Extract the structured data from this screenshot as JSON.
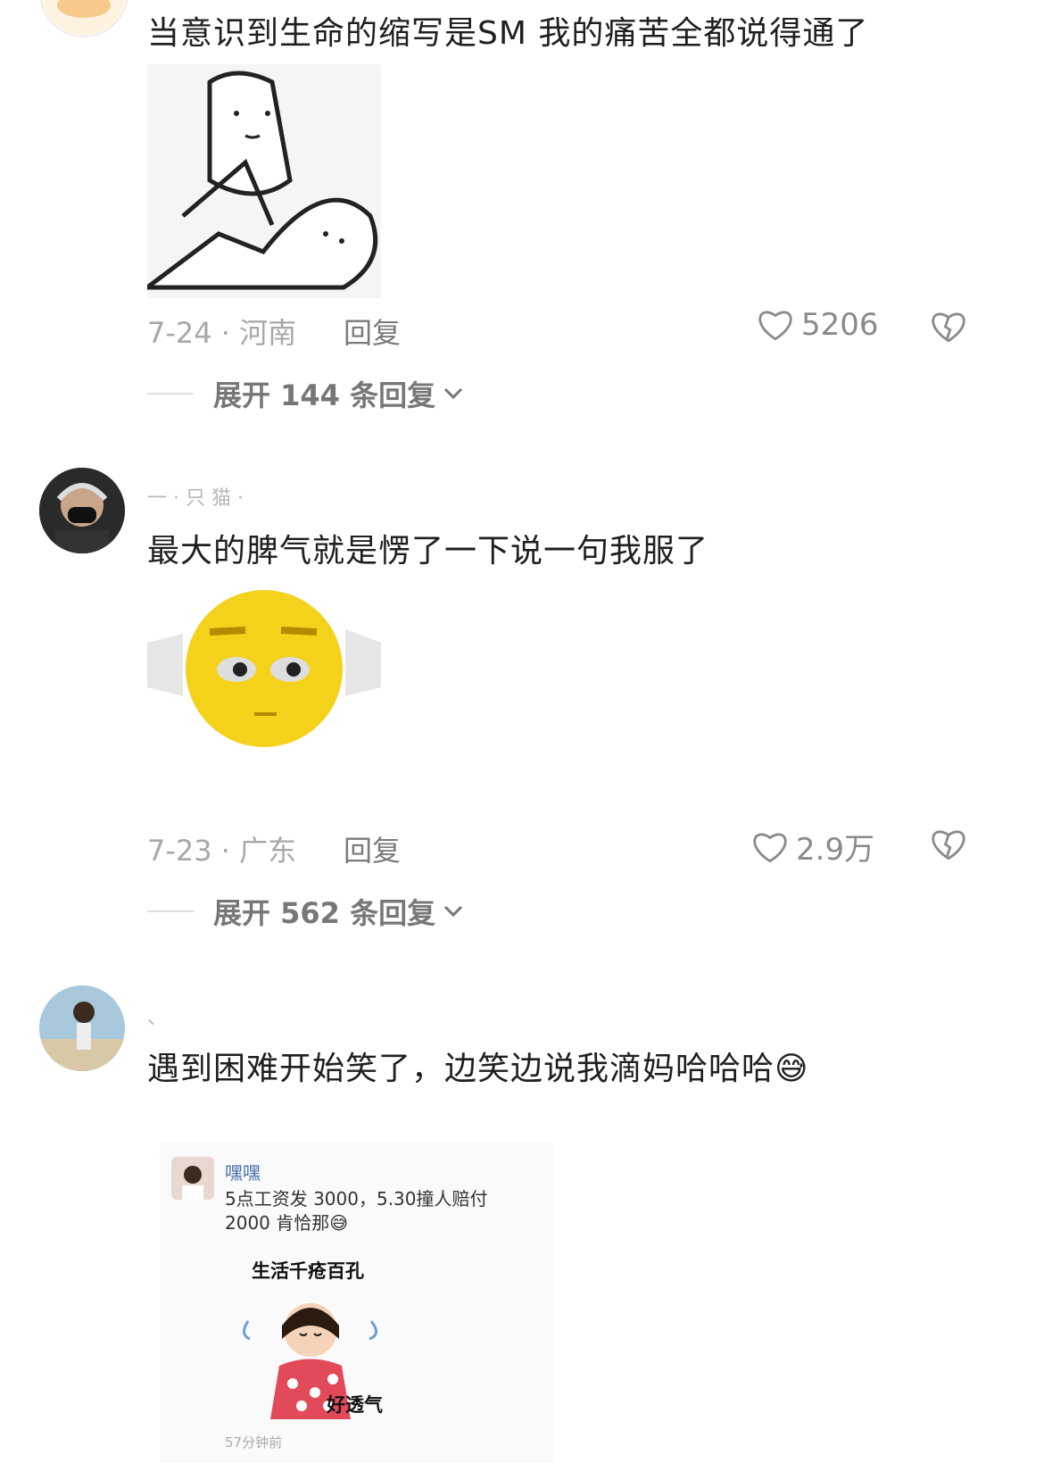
{
  "comments": [
    {
      "text": "当意识到生命的缩写是SM 我的痛苦全都说得通了",
      "date_location": "7-24 · 河南",
      "reply_label": "回复",
      "likes": "5206",
      "expand_label": "展开 144 条回复"
    },
    {
      "username": "一 · 只 猫 ·",
      "text": "最大的脾气就是愣了一下说一句我服了",
      "date_location": "7-23 · 广东",
      "reply_label": "回复",
      "likes": "2.9万",
      "expand_label": "展开 562 条回复"
    },
    {
      "username": "、",
      "text": "遇到困难开始笑了，边笑边说我滴妈哈哈哈😅"
    }
  ],
  "inner_post": {
    "name": "嘿嘿",
    "text": "5点工资发 3000，5.30撞人赔付 2000 肯恰那😅",
    "sticker_title": "生活千疮百孔",
    "sticker_caption": "好透气",
    "time": "57分钟前"
  },
  "colors": {
    "like_gray": "#8a8a8a",
    "sticker_yellow": "#f4d11a"
  }
}
